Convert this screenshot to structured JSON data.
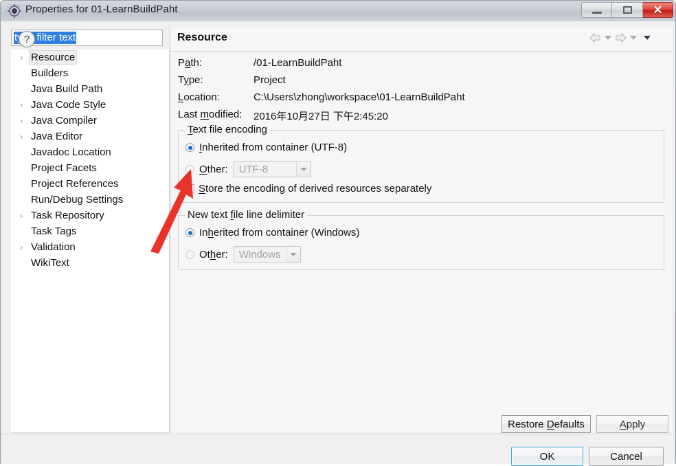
{
  "window": {
    "title": "Properties for 01-LearnBuildPaht",
    "icon": "properties-gear-icon",
    "minimize_label": "–",
    "maximize_label": "□",
    "close_label": "✕"
  },
  "sidebar": {
    "filter": {
      "value": "type filter text",
      "placeholder": "type filter text",
      "selected": true
    },
    "items": [
      {
        "label": "Resource",
        "expandable": true,
        "selected": true
      },
      {
        "label": "Builders",
        "expandable": false,
        "selected": false
      },
      {
        "label": "Java Build Path",
        "expandable": false,
        "selected": false
      },
      {
        "label": "Java Code Style",
        "expandable": true,
        "selected": false
      },
      {
        "label": "Java Compiler",
        "expandable": true,
        "selected": false
      },
      {
        "label": "Java Editor",
        "expandable": true,
        "selected": false
      },
      {
        "label": "Javadoc Location",
        "expandable": false,
        "selected": false
      },
      {
        "label": "Project Facets",
        "expandable": false,
        "selected": false
      },
      {
        "label": "Project References",
        "expandable": false,
        "selected": false
      },
      {
        "label": "Run/Debug Settings",
        "expandable": false,
        "selected": false
      },
      {
        "label": "Task Repository",
        "expandable": true,
        "selected": false
      },
      {
        "label": "Task Tags",
        "expandable": false,
        "selected": false
      },
      {
        "label": "Validation",
        "expandable": true,
        "selected": false
      },
      {
        "label": "WikiText",
        "expandable": false,
        "selected": false
      }
    ],
    "twisty_glyph": "›"
  },
  "content": {
    "title": "Resource",
    "nav": {
      "back_icon": "back-arrow-icon",
      "back_menu_icon": "chevron-down-icon",
      "forward_icon": "forward-arrow-icon",
      "forward_menu_icon": "chevron-down-icon",
      "menu_icon": "chevron-down-icon"
    },
    "properties": [
      {
        "label_pre": "P",
        "label_mn": "a",
        "label_post": "th:",
        "value": "/01-LearnBuildPaht"
      },
      {
        "label_pre": "T",
        "label_mn": "y",
        "label_post": "pe:",
        "value": "Project"
      },
      {
        "label_pre": "",
        "label_mn": "L",
        "label_post": "ocation:",
        "value": "C:\\Users\\zhong\\workspace\\01-LearnBuildPaht"
      },
      {
        "label_pre": "Last ",
        "label_mn": "m",
        "label_post": "odified:",
        "value": "2016年10月27日 下午2:45:20"
      }
    ],
    "encoding_group": {
      "title_pre": "",
      "title_mn": "T",
      "title_post": "ext file encoding",
      "inherited": {
        "label_pre": "",
        "label_mn": "I",
        "label_post": "nherited from container (UTF-8)",
        "checked": true,
        "enabled": true
      },
      "other": {
        "label_pre": "",
        "label_mn": "O",
        "label_post": "ther:",
        "checked": false,
        "enabled": false,
        "combo_value": "UTF-8"
      },
      "store_separately": {
        "label_pre": "",
        "label_mn": "S",
        "label_post": "tore the encoding of derived resources separately",
        "checked": false
      }
    },
    "delimiter_group": {
      "title_pre": "New text ",
      "title_mn": "f",
      "title_post": "ile line delimiter",
      "inherited": {
        "label_pre": "In",
        "label_mn": "h",
        "label_post": "erited from container (Windows)",
        "checked": true,
        "enabled": true
      },
      "other": {
        "label_pre": "Ot",
        "label_mn": "h",
        "label_post": "er:",
        "checked": false,
        "enabled": false,
        "combo_value": "Windows"
      }
    },
    "restore_defaults": {
      "pre": "Restore ",
      "mn": "D",
      "post": "efaults"
    },
    "apply": {
      "pre": "",
      "mn": "A",
      "post": "pply"
    }
  },
  "footer": {
    "help_label": "?",
    "ok_label": "OK",
    "cancel_label": "Cancel"
  },
  "annotation": {
    "arrow_color": "#e8322a",
    "description": "red-arrow pointing at Other radio button"
  }
}
